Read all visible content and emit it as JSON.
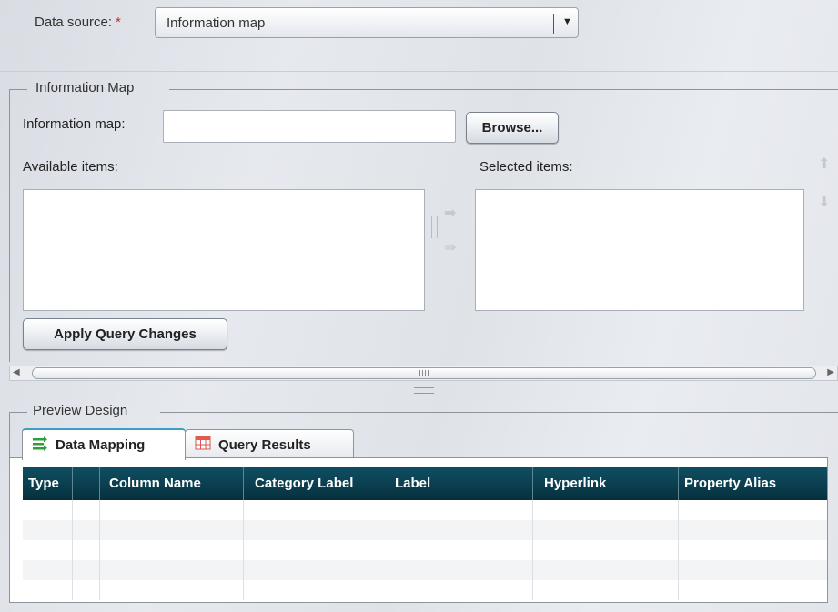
{
  "data_source": {
    "label": "Data source:",
    "required_marker": "*",
    "selected": "Information map"
  },
  "information_map_group": {
    "legend": "Information Map",
    "field_label": "Information map:",
    "field_value": "",
    "browse_label": "Browse...",
    "available_label": "Available items:",
    "selected_label": "Selected items:",
    "apply_label": "Apply Query Changes"
  },
  "preview_design": {
    "legend": "Preview Design",
    "tabs": [
      {
        "label": "Data Mapping",
        "icon": "data-mapping-icon",
        "active": true
      },
      {
        "label": "Query Results",
        "icon": "table-icon",
        "active": false
      }
    ],
    "columns": [
      "Type",
      "",
      "Column Name",
      "Category Label",
      "Label",
      "Hyperlink",
      "Property Alias"
    ]
  },
  "colors": {
    "grid_header": "#0a3d4e",
    "required": "#d9261c",
    "tab_accent": "#3aa0c8",
    "mapping_icon": "#2e9e3e"
  }
}
